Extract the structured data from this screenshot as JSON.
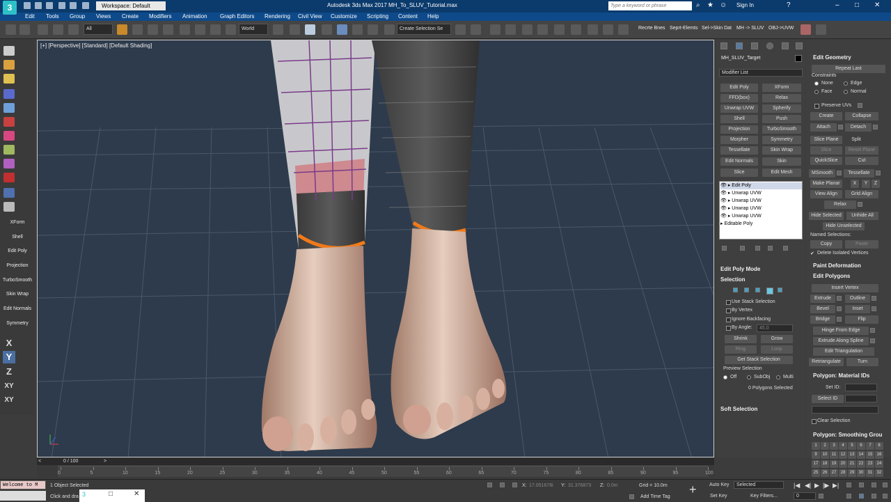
{
  "app": {
    "title": "Autodesk 3ds Max 2017      MH_To_SLUV_Tutorial.max",
    "workspace": "Workspace: Default",
    "search_placeholder": "Type a keyword or phrase",
    "sign_in": "Sign In"
  },
  "menu": [
    "Edit",
    "Tools",
    "Group",
    "Views",
    "Create",
    "Modifiers",
    "Animation",
    "Graph Editors",
    "Rendering",
    "Civil View",
    "Customize",
    "Scripting",
    "Content",
    "Help"
  ],
  "toolbar": {
    "filter_all": "All",
    "ref_coord": "World",
    "selection_set": "Create Selection Se",
    "custom_buttons": [
      "Recrte Bnes",
      "Seprt-Elemts",
      "Sel->Skin Dat",
      "MH -> SLUV",
      "OBJ->UVW"
    ]
  },
  "left_panel": {
    "modifier_buttons": [
      "XForm",
      "Shell",
      "Edit Poly",
      "Projection",
      "TurboSmooth",
      "Skin Wrap",
      "Edit Normals",
      "Symmetry"
    ],
    "axes": [
      "X",
      "Y",
      "Z",
      "XY",
      "XY"
    ]
  },
  "viewport": {
    "label": "[+] [Perspective] [Standard] [Default Shading]"
  },
  "command_panel": {
    "object_name": "MH_SLUV_Target",
    "modifier_list": "Modifier List",
    "modifier_buttons": [
      [
        "Edit Poly",
        "XForm"
      ],
      [
        "FFD(box)",
        "Relax"
      ],
      [
        "Unwrap UVW",
        "Spherify"
      ],
      [
        "Shell",
        "Push"
      ],
      [
        "Projection",
        "TurboSmooth"
      ],
      [
        "Morpher",
        "Symmetry"
      ],
      [
        "Tessellate",
        "Skin Wrap"
      ],
      [
        "Edit Normals",
        "Skin"
      ],
      [
        "Slice",
        "Edit Mesh"
      ]
    ],
    "stack": [
      "Edit Poly",
      "Unwrap UVW",
      "Unwrap UVW",
      "Unwrap UVW",
      "Unwrap UVW",
      "Editable Poly"
    ],
    "edit_poly_mode": "Edit Poly Mode",
    "selection": {
      "title": "Selection",
      "use_stack": "Use Stack Selection",
      "by_vertex": "By Vertex",
      "ignore_backfacing": "Ignore Backfacing",
      "by_angle": "By Angle:",
      "by_angle_value": "45.0",
      "shrink": "Shrink",
      "grow": "Grow",
      "ring": "Ring",
      "loop": "Loop",
      "get_stack": "Get Stack Selection",
      "preview_selection": "Preview Selection",
      "preview_options": [
        "Off",
        "SubObj",
        "Multi"
      ],
      "status": "0 Polygons Selected"
    },
    "soft_selection": "Soft Selection"
  },
  "right_panel": {
    "edit_geometry": "Edit Geometry",
    "repeat_last": "Repeat Last",
    "constraints": "Constraints",
    "constraint_options": [
      "None",
      "Edge",
      "Face",
      "Normal"
    ],
    "preserve_uvs": "Preserve UVs",
    "create": "Create",
    "collapse": "Collapse",
    "attach": "Attach",
    "detach": "Detach",
    "slice_plane": "Slice Plane",
    "split": "Split",
    "slice": "Slice",
    "reset_plane": "Reset Plane",
    "quickslice": "QuickSlice",
    "cut": "Cut",
    "msmooth": "MSmooth",
    "tessellate": "Tessellate",
    "make_planar": "Make Planar",
    "axis_x": "X",
    "axis_y": "Y",
    "axis_z": "Z",
    "view_align": "View Align",
    "grid_align": "Grid Align",
    "relax": "Relax",
    "hide_selected": "Hide Selected",
    "unhide_all": "Unhide All",
    "hide_unselected": "Hide Unselected",
    "named_selections": "Named Selections:",
    "copy": "Copy",
    "paste": "Paste",
    "delete_isolated": "Delete Isolated Vertices",
    "paint_deformation": "Paint Deformation",
    "edit_polygons": "Edit Polygons",
    "insert_vertex": "Insert Vertex",
    "extrude": "Extrude",
    "outline": "Outline",
    "bevel": "Bevel",
    "inset": "Inset",
    "bridge": "Bridge",
    "flip": "Flip",
    "hinge": "Hinge From Edge",
    "extrude_spline": "Extrude Along Spline",
    "edit_triangulation": "Edit Triangulation",
    "retriangulate": "Retriangulate",
    "turn": "Turn",
    "material_ids": "Polygon: Material IDs",
    "set_id": "Set ID:",
    "select_id": "Select ID",
    "clear_selection": "Clear Selection",
    "smoothing_groups": "Polygon: Smoothing Grou",
    "smoothing_numbers": [
      "1",
      "2",
      "3",
      "4",
      "5",
      "6",
      "7",
      "8",
      "9",
      "10",
      "11",
      "12",
      "13",
      "14",
      "15",
      "16",
      "17",
      "18",
      "19",
      "20",
      "21",
      "22",
      "23",
      "24",
      "25",
      "26",
      "27",
      "28",
      "29",
      "30",
      "31",
      "32"
    ]
  },
  "timeline": {
    "frame": "0 / 100",
    "ticks": [
      "0",
      "5",
      "10",
      "15",
      "20",
      "25",
      "30",
      "35",
      "40",
      "45",
      "50",
      "55",
      "60",
      "65",
      "70",
      "75",
      "80",
      "85",
      "90",
      "95",
      "100"
    ]
  },
  "status": {
    "maxscript": "Welcome to M",
    "selected": "1 Object Selected",
    "hint": "Click and dra",
    "x_label": "X:",
    "x_value": "17.051678i",
    "y_label": "Y:",
    "y_value": "31.376873",
    "z_label": "Z:",
    "z_value": "0.0m",
    "grid": "Grid = 10.0m",
    "add_time_tag": "Add Time Tag",
    "auto_key": "Auto Key",
    "auto_key_value": "Selected",
    "set_key": "Set Key",
    "key_filters": "Key Filters...",
    "frame_value": "0"
  },
  "colors": {
    "title_bar": "#0b3a6c",
    "menu_bar": "#0e4a8a",
    "viewport_bg": "#2e3b4c",
    "selection_orange": "#f07a1a",
    "uv_checker_purple": "#7a3a8a"
  }
}
